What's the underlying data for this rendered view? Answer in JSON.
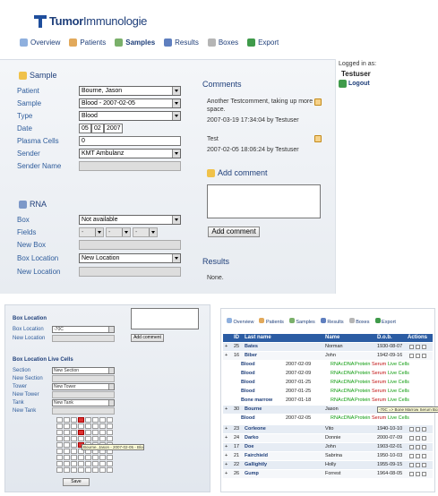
{
  "brand": {
    "name_bold": "Tumor",
    "name_light": "Immunologie"
  },
  "nav": [
    {
      "label": "Overview",
      "icon": "overview-icon",
      "active": false
    },
    {
      "label": "Patients",
      "icon": "patients-icon",
      "active": false
    },
    {
      "label": "Samples",
      "icon": "samples-icon",
      "active": true
    },
    {
      "label": "Results",
      "icon": "results-icon",
      "active": false
    },
    {
      "label": "Boxes",
      "icon": "boxes-icon",
      "active": false
    },
    {
      "label": "Export",
      "icon": "export-icon",
      "active": false
    }
  ],
  "sample": {
    "title": "Sample",
    "patient_label": "Patient",
    "patient_value": "Bourne, Jason",
    "sample_label": "Sample",
    "sample_value": "Blood - 2007-02-05",
    "type_label": "Type",
    "type_value": "Blood",
    "date_label": "Date",
    "date_day": "05",
    "date_month": "02",
    "date_year": "2007",
    "plasma_label": "Plasma Cells",
    "plasma_value": "0",
    "sender_label": "Sender",
    "sender_value": "KMT Ambulanz",
    "sender_name_label": "Sender Name",
    "sender_name_value": ""
  },
  "rna": {
    "title": "RNA",
    "box_label": "Box",
    "box_value": "Not available",
    "fields_label": "Fields",
    "new_box_label": "New Box",
    "box_location_label": "Box Location",
    "box_location_value": "New Location",
    "new_location_label": "New Location"
  },
  "comments": {
    "title": "Comments",
    "items": [
      {
        "text": "Another Testcomment, taking up more space.",
        "meta": "2007-03-19 17:34:04 by Testuser"
      },
      {
        "text": "Test",
        "meta": "2007-02-05 18:06:24 by Testuser"
      }
    ],
    "add_title": "Add comment",
    "add_button": "Add comment"
  },
  "results": {
    "title": "Results",
    "value": "None."
  },
  "user": {
    "logged_in_label": "Logged in as:",
    "name": "Testuser",
    "logout": "Logout"
  },
  "bottom_left": {
    "box_location_title": "Box Location",
    "box_location_label": "Box Location",
    "box_location_value": "-70C",
    "new_location_label": "New Location",
    "add_comment_button": "Add comment",
    "live_cells_title": "Box Location Live Cells",
    "section_label": "Section",
    "section_value": "New Section",
    "new_section_label": "New Section",
    "tower_label": "Tower",
    "tower_value": "New Tower",
    "new_tower_label": "New Tower",
    "tank_label": "Tank",
    "tank_value": "New Tank",
    "new_tank_label": "New Tank",
    "tooltip": "Bourne, Jason - 2007-02-05 - Blood/Serum",
    "save_button": "Save"
  },
  "bottom_right": {
    "nav": [
      "Overview",
      "Patients",
      "Samples",
      "Results",
      "Boxes",
      "Export"
    ],
    "headers": [
      "ID",
      "Last name",
      "Name",
      "D.o.b.",
      "Actions"
    ],
    "patients": [
      {
        "id": "25",
        "last": "Bates",
        "first": "Norman",
        "dob": "1930-08-07"
      },
      {
        "id": "16",
        "last": "Biber",
        "first": "John",
        "dob": "1942-09-16"
      }
    ],
    "samples_biber": [
      {
        "type": "Blood",
        "date": "2007-02-09"
      },
      {
        "type": "Blood",
        "date": "2007-02-09"
      },
      {
        "type": "Blood",
        "date": "2007-01-25"
      },
      {
        "type": "Blood",
        "date": "2007-01-25"
      },
      {
        "type": "Bone marrow",
        "date": "2007-01-18"
      }
    ],
    "sample_tags": [
      "RNA",
      "cDNA",
      "Protein",
      "Serum",
      "Live Cells"
    ],
    "bourne": {
      "id": "30",
      "last": "Bourne",
      "first": "Jason",
      "tooltip": "-70C => Bone Marrow Serum Box"
    },
    "sample_bourne": {
      "type": "Blood",
      "date": "2007-02-05"
    },
    "more_patients": [
      {
        "id": "23",
        "last": "Corleone",
        "first": "Vito",
        "dob": "1940-10-10"
      },
      {
        "id": "24",
        "last": "Darko",
        "first": "Donnie",
        "dob": "2000-07-09"
      },
      {
        "id": "17",
        "last": "Doe",
        "first": "John",
        "dob": "1903-02-01"
      },
      {
        "id": "21",
        "last": "Fairchield",
        "first": "Sabrina",
        "dob": "1950-10-03"
      },
      {
        "id": "22",
        "last": "Gallightly",
        "first": "Holly",
        "dob": "1955-09-15"
      },
      {
        "id": "26",
        "last": "Gump",
        "first": "Forrest",
        "dob": "1964-08-05"
      }
    ]
  },
  "colors": {
    "brand": "#1f3f7a",
    "label": "#2f5d9c",
    "table_header": "#2b5ca3",
    "tag_green": "#0a9a0a",
    "tag_red": "#c01010"
  }
}
